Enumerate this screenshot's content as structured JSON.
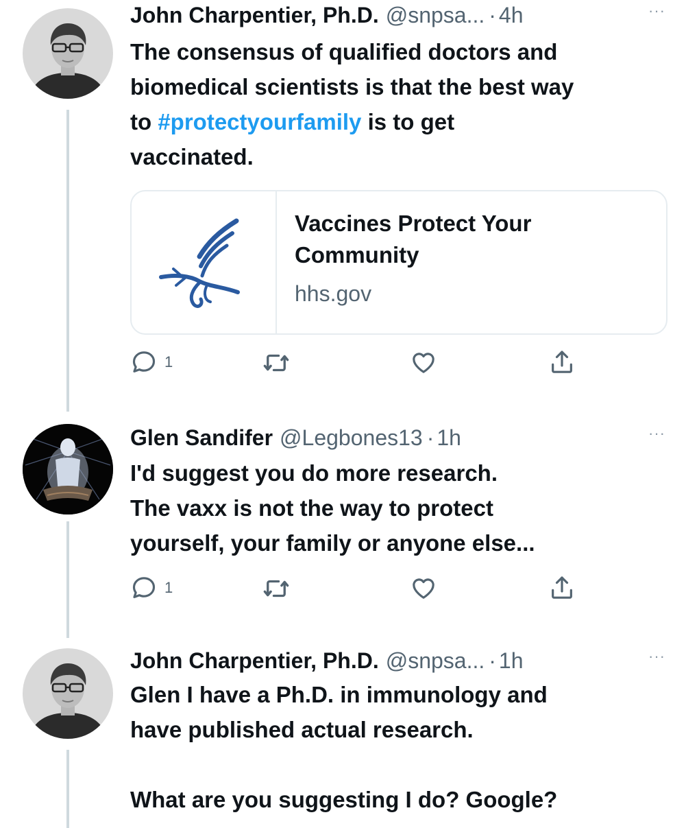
{
  "tweets": [
    {
      "name": "John Charpentier, Ph.D.",
      "handle": "@snpsa...",
      "dot": "·",
      "time": "4h",
      "more": "···",
      "text_before": "The consensus of qualified doctors and\nbiomedical scientists is that the best way\nto ",
      "hashtag": "#protectyourfamily",
      "text_after": " is to get\nvaccinated.",
      "card": {
        "title": "Vaccines Protect Your\nCommunity",
        "domain": "hhs.gov"
      },
      "reply_count": "1"
    },
    {
      "name": "Glen Sandifer",
      "handle": "@Legbones13",
      "dot": "·",
      "time": "1h",
      "more": "···",
      "text": "I'd suggest you do more research.\nThe vaxx is not the way to protect\nyourself, your family or anyone else...",
      "reply_count": "1"
    },
    {
      "name": "John Charpentier, Ph.D.",
      "handle": "@snpsa...",
      "dot": "·",
      "time": "1h",
      "more": "···",
      "text": "Glen I have a Ph.D. in immunology and\nhave published actual research.\n\nWhat are you suggesting I do? Google?"
    }
  ],
  "icons": {
    "reply": "reply-icon",
    "retweet": "retweet-icon",
    "like": "heart-icon",
    "share": "share-icon",
    "more": "more-icon",
    "card_logo": "hhs-eagle-logo"
  },
  "colors": {
    "text": "#0f1419",
    "secondary": "#536471",
    "link": "#1d9bf0",
    "border": "#e6ecf0",
    "thread_line": "#cfd9de",
    "logo_blue": "#2a5aa0"
  }
}
